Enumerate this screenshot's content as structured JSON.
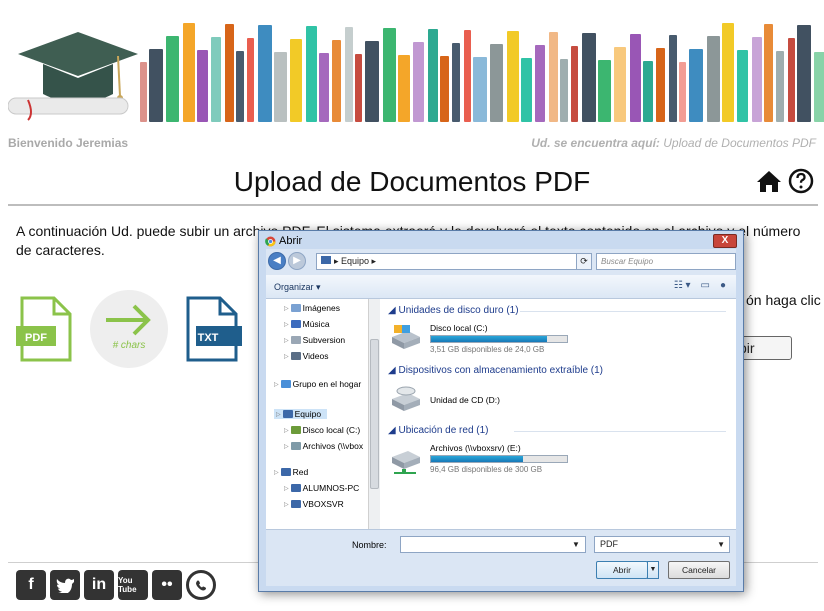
{
  "header": {
    "welcome": "Bienvenido Jeremias",
    "location_label": "Ud. se encuentra aquí:",
    "location_value": "Upload de Documentos PDF"
  },
  "page": {
    "title": "Upload de Documentos PDF",
    "description": "A continuación Ud. puede subir un archivo PDF. El sistema extraerá y le devolverá el texto contenido en el archivo y el número de caracteres.",
    "side_text": "ón haga clic",
    "upload_button": "bir",
    "chars_label": "# chars",
    "pdf_label": "PDF",
    "txt_label": "TXT"
  },
  "social": [
    "f",
    "t",
    "in",
    "You Tube",
    "••",
    "whatsapp"
  ],
  "dialog": {
    "title": "Abrir",
    "close": "X",
    "address": "▸ Equipo ▸",
    "search_placeholder": "Buscar Equipo",
    "organize": "Organizar ▾",
    "tree": [
      {
        "label": "Imágenes",
        "indent": 1,
        "color": "#7aa1d2"
      },
      {
        "label": "Música",
        "indent": 1,
        "color": "#3d6cbe"
      },
      {
        "label": "Subversion",
        "indent": 1,
        "color": "#9aa7b5"
      },
      {
        "label": "Videos",
        "indent": 1,
        "color": "#5a6e86"
      },
      {
        "label": "Grupo en el hogar",
        "indent": 0,
        "color": "#4a8fd8"
      },
      {
        "label": "Equipo",
        "indent": 0,
        "color": "#3c68a8"
      },
      {
        "label": "Disco local (C:)",
        "indent": 1,
        "color": "#6c9b3a"
      },
      {
        "label": "Archivos (\\\\vbox",
        "indent": 1,
        "color": "#7f9ba8"
      },
      {
        "label": "Red",
        "indent": 0,
        "color": "#3c68a8"
      },
      {
        "label": "ALUMNOS-PC",
        "indent": 1,
        "color": "#3c68a8"
      },
      {
        "label": "VBOXSVR",
        "indent": 1,
        "color": "#3c68a8"
      }
    ],
    "groups": {
      "hdd": "Unidades de disco duro (1)",
      "removable": "Dispositivos con almacenamiento extraíble (1)",
      "network": "Ubicación de red (1)"
    },
    "drives": {
      "c_name": "Disco local (C:)",
      "c_free": "3,51 GB disponibles de 24,0 GB",
      "c_used_fraction": 0.85,
      "cd_name": "Unidad de CD (D:)",
      "e_name": "Archivos (\\\\vboxsrv) (E:)",
      "e_free": "96,4 GB disponibles de 300 GB",
      "e_used_fraction": 0.68
    },
    "filename_label": "Nombre:",
    "filetype": "PDF",
    "open_button": "Abrir",
    "cancel_button": "Cancelar"
  }
}
